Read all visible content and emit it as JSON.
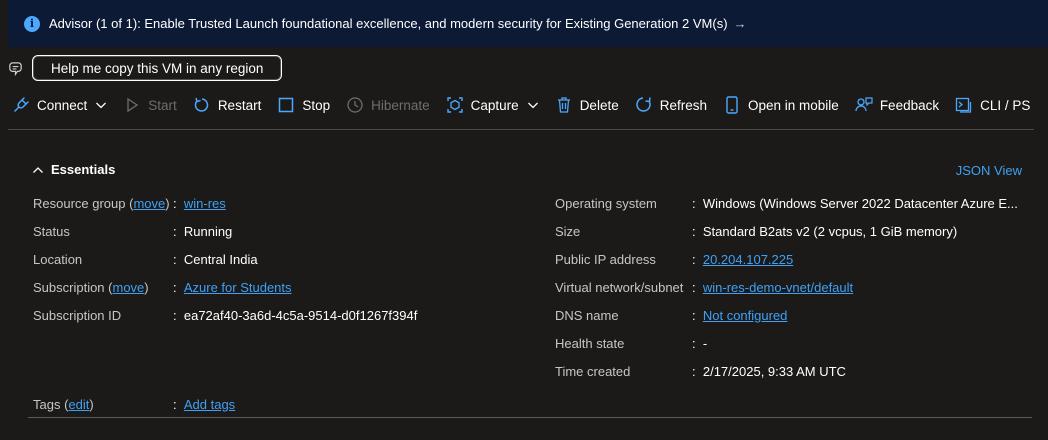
{
  "advisor": {
    "text": "Advisor (1 of 1): Enable Trusted Launch foundational excellence, and modern security for Existing Generation 2 VM(s)",
    "arrow": "→"
  },
  "copilot": {
    "button_label": "Help me copy this VM in any region"
  },
  "toolbar": {
    "connect": "Connect",
    "start": "Start",
    "restart": "Restart",
    "stop": "Stop",
    "hibernate": "Hibernate",
    "capture": "Capture",
    "delete": "Delete",
    "refresh": "Refresh",
    "open_mobile": "Open in mobile",
    "feedback": "Feedback",
    "cli": "CLI / PS"
  },
  "essentials": {
    "title": "Essentials",
    "json_view": "JSON View",
    "left": {
      "resource_group": {
        "label": "Resource group",
        "move": "move",
        "value": "win-res"
      },
      "status": {
        "label": "Status",
        "value": "Running"
      },
      "location": {
        "label": "Location",
        "value": "Central India"
      },
      "subscription": {
        "label": "Subscription",
        "move": "move",
        "value": "Azure for Students"
      },
      "subscription_id": {
        "label": "Subscription ID",
        "value": "ea72af40-3a6d-4c5a-9514-d0f1267f394f"
      }
    },
    "right": {
      "os": {
        "label": "Operating system",
        "value": "Windows (Windows Server 2022 Datacenter Azure E..."
      },
      "size": {
        "label": "Size",
        "value": "Standard B2ats v2 (2 vcpus, 1 GiB memory)"
      },
      "public_ip": {
        "label": "Public IP address",
        "value": "20.204.107.225"
      },
      "vnet": {
        "label": "Virtual network/subnet",
        "value": "win-res-demo-vnet/default"
      },
      "dns": {
        "label": "DNS name",
        "value": "Not configured"
      },
      "health": {
        "label": "Health state",
        "value": "-"
      },
      "time_created": {
        "label": "Time created",
        "value": "2/17/2025, 9:33 AM UTC"
      }
    },
    "tags": {
      "label": "Tags",
      "edit": "edit",
      "value": "Add tags"
    },
    "separator": ":"
  }
}
